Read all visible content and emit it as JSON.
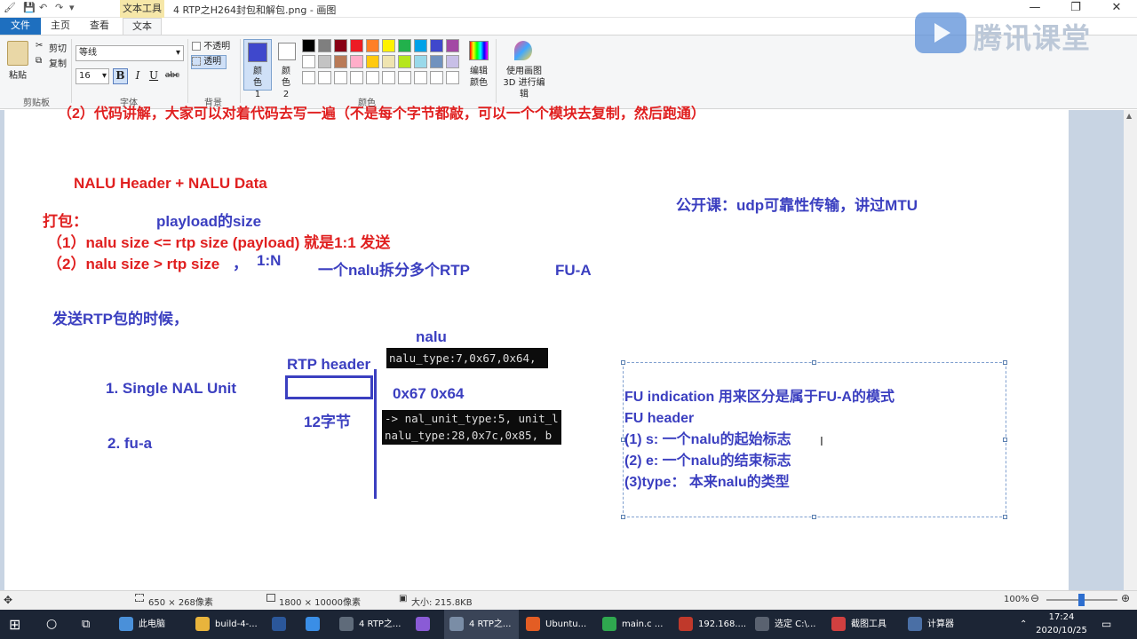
{
  "window": {
    "context_tab": "文本工具",
    "title": "4 RTP之H264封包和解包.png - 画图",
    "min": "—",
    "max": "❐",
    "close": "✕"
  },
  "tabs": {
    "file": "文件",
    "home": "主页",
    "view": "查看",
    "text": "文本"
  },
  "ribbon": {
    "clipboard": {
      "paste": "粘贴",
      "cut": "剪切",
      "copy": "复制",
      "label": "剪贴板"
    },
    "font": {
      "family": "等线",
      "size": "16",
      "bold": "B",
      "italic": "I",
      "underline": "U",
      "strike": "abc",
      "label": "字体"
    },
    "background": {
      "opaque": "不透明",
      "transparent": "透明",
      "label": "背景"
    },
    "color1": "颜色 1",
    "color2": "颜色 2",
    "edit_colors": "编辑颜色",
    "paint3d": "使用画图 3D 进行编辑",
    "colors_label": "颜色",
    "palette_row1": [
      "#000000",
      "#7f7f7f",
      "#880015",
      "#ed1c24",
      "#ff7f27",
      "#fff200",
      "#22b14c",
      "#00a2e8",
      "#3f48cc",
      "#a349a4"
    ],
    "palette_row2": [
      "#ffffff",
      "#c3c3c3",
      "#b97a57",
      "#ffaec9",
      "#ffc90e",
      "#efe4b0",
      "#b5e61d",
      "#99d9ea",
      "#7092be",
      "#c8bfe7"
    ],
    "color1_hex": "#3f48cc",
    "color2_hex": "#ffffff"
  },
  "watermark": "腾讯课堂",
  "canvas": {
    "top_cut": "（2）代码讲解，大家可以对着代码去写一遍（不是每个字节都敲，可以一个个模块去复制，然后跑通）",
    "nalu_header": "NALU Header + NALU Data",
    "pack": "打包：",
    "payload": "playload的size",
    "case1": "（1）nalu size <= rtp size (payload) 就是1:1 发送",
    "case2": "（2）nalu size > rtp size",
    "comma": "，",
    "ratio": "1:N",
    "split": "一个nalu拆分多个RTP",
    "fua": "FU-A",
    "public_class": "公开课：udp可靠性传输，讲过MTU",
    "send_rtp": "发送RTP包的时候，",
    "nalu": "nalu",
    "code1": "nalu_type:7,0x67,0x64,",
    "rtp_header": "RTP header",
    "hex": "0x67 0x64",
    "single": "1. Single NAL Unit",
    "bytes": "12字节",
    "code2a": "-> nal_unit_type:5, unit_l",
    "code2b": "nalu_type:28,0x7c,0x85, b",
    "fua_item": "2. fu-a",
    "box_lines": [
      "FU indication 用来区分是属于FU-A的模式",
      "FU header",
      "(1) s: 一个nalu的起始标志",
      "(2) e: 一个nalu的结束标志",
      "(3)type： 本来nalu的类型"
    ]
  },
  "status": {
    "selection": "650 × 268像素",
    "image_size": "1800 × 10000像素",
    "file_size": "大小: 215.8KB",
    "zoom": "100%",
    "zoom_level": 1.0
  },
  "taskbar": {
    "items": [
      "此电脑",
      "build-4-...",
      "",
      "",
      "4 RTP之...",
      "",
      "4 RTP之...",
      "Ubuntu...",
      "main.c ...",
      "192.168....",
      "选定 C:\\...",
      "截图工具",
      "计算器"
    ],
    "time": "17:24",
    "date": "2020/10/25"
  }
}
